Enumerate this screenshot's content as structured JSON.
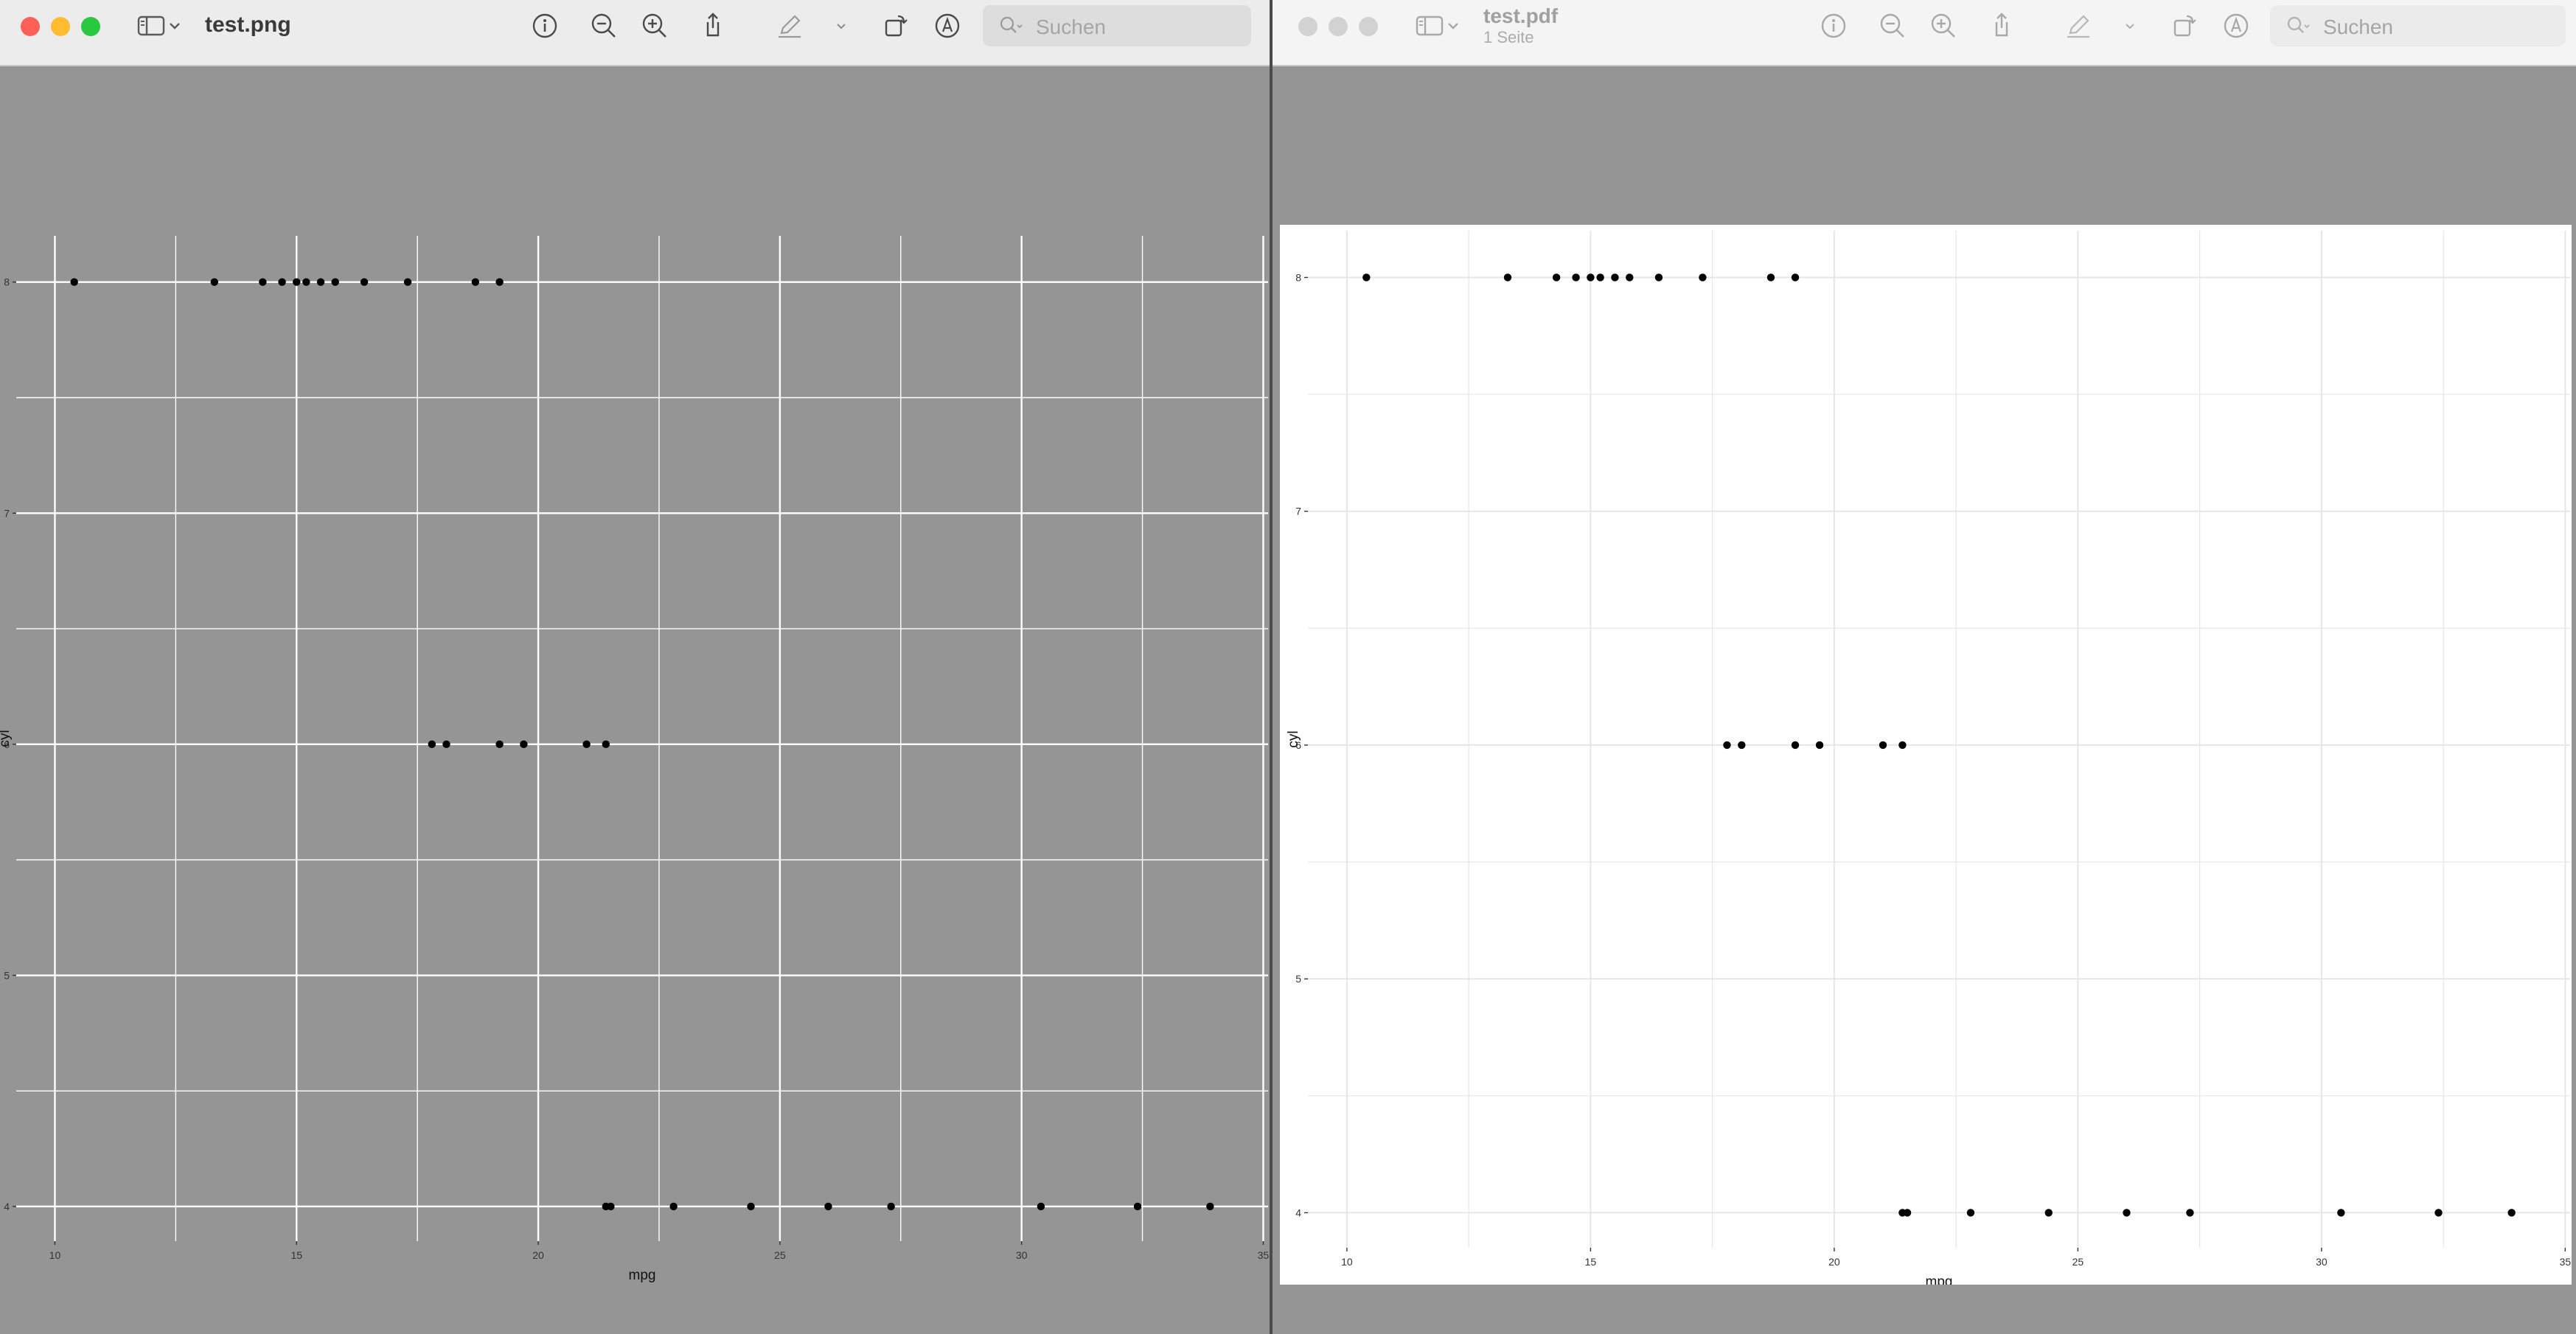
{
  "windows": [
    {
      "title": "test.png",
      "subtitle": "",
      "search_placeholder": "Suchen"
    },
    {
      "title": "test.pdf",
      "subtitle": "1 Seite",
      "search_placeholder": "Suchen"
    }
  ],
  "icons": {
    "sidebar": "sidebar-icon",
    "chevron": "chevron-down-icon",
    "info": "info-icon",
    "zoom_out": "zoom-out-icon",
    "zoom_in": "zoom-in-icon",
    "share": "share-icon",
    "markup": "pencil-icon",
    "rotate": "rotate-icon",
    "annotate": "markup-icon",
    "search": "search-icon"
  },
  "colors": {
    "close": "#fe5f57",
    "minimize": "#febc2e",
    "zoom": "#28c840",
    "inactive": "#d2d2d2",
    "png_panel_background": "#959595",
    "pdf_panel_background": "#ffffff"
  },
  "chart_data": [
    {
      "type": "scatter",
      "xlabel": "mpg",
      "ylabel": "cyl",
      "xlim": [
        9.2,
        35.1
      ],
      "ylim": [
        3.85,
        8.2
      ],
      "x_ticks": [
        "10",
        "15",
        "20",
        "25",
        "30",
        "35"
      ],
      "y_ticks": [
        "4",
        "5",
        "6",
        "7",
        "8"
      ],
      "grid": true,
      "legend": "none",
      "background": "grey",
      "points": [
        {
          "x": 10.4,
          "y": 8
        },
        {
          "x": 13.3,
          "y": 8
        },
        {
          "x": 14.3,
          "y": 8
        },
        {
          "x": 14.7,
          "y": 8
        },
        {
          "x": 15.0,
          "y": 8
        },
        {
          "x": 15.2,
          "y": 8
        },
        {
          "x": 15.5,
          "y": 8
        },
        {
          "x": 15.8,
          "y": 8
        },
        {
          "x": 16.4,
          "y": 8
        },
        {
          "x": 17.3,
          "y": 8
        },
        {
          "x": 18.7,
          "y": 8
        },
        {
          "x": 19.2,
          "y": 8
        },
        {
          "x": 17.8,
          "y": 6
        },
        {
          "x": 18.1,
          "y": 6
        },
        {
          "x": 19.2,
          "y": 6
        },
        {
          "x": 19.7,
          "y": 6
        },
        {
          "x": 21.0,
          "y": 6
        },
        {
          "x": 21.4,
          "y": 6
        },
        {
          "x": 21.4,
          "y": 4
        },
        {
          "x": 21.5,
          "y": 4
        },
        {
          "x": 22.8,
          "y": 4
        },
        {
          "x": 24.4,
          "y": 4
        },
        {
          "x": 26.0,
          "y": 4
        },
        {
          "x": 27.3,
          "y": 4
        },
        {
          "x": 30.4,
          "y": 4
        },
        {
          "x": 32.4,
          "y": 4
        },
        {
          "x": 33.9,
          "y": 4
        }
      ]
    },
    {
      "type": "scatter",
      "xlabel": "mpg",
      "ylabel": "cyl",
      "xlim": [
        9.2,
        35.1
      ],
      "ylim": [
        3.85,
        8.2
      ],
      "x_ticks": [
        "10",
        "15",
        "20",
        "25",
        "30",
        "35"
      ],
      "y_ticks": [
        "4",
        "5",
        "6",
        "7",
        "8"
      ],
      "grid": true,
      "legend": "none",
      "background": "white",
      "points": [
        {
          "x": 10.4,
          "y": 8
        },
        {
          "x": 13.3,
          "y": 8
        },
        {
          "x": 14.3,
          "y": 8
        },
        {
          "x": 14.7,
          "y": 8
        },
        {
          "x": 15.0,
          "y": 8
        },
        {
          "x": 15.2,
          "y": 8
        },
        {
          "x": 15.5,
          "y": 8
        },
        {
          "x": 15.8,
          "y": 8
        },
        {
          "x": 16.4,
          "y": 8
        },
        {
          "x": 17.3,
          "y": 8
        },
        {
          "x": 18.7,
          "y": 8
        },
        {
          "x": 19.2,
          "y": 8
        },
        {
          "x": 17.8,
          "y": 6
        },
        {
          "x": 18.1,
          "y": 6
        },
        {
          "x": 19.2,
          "y": 6
        },
        {
          "x": 19.7,
          "y": 6
        },
        {
          "x": 21.0,
          "y": 6
        },
        {
          "x": 21.4,
          "y": 6
        },
        {
          "x": 21.4,
          "y": 4
        },
        {
          "x": 21.5,
          "y": 4
        },
        {
          "x": 22.8,
          "y": 4
        },
        {
          "x": 24.4,
          "y": 4
        },
        {
          "x": 26.0,
          "y": 4
        },
        {
          "x": 27.3,
          "y": 4
        },
        {
          "x": 30.4,
          "y": 4
        },
        {
          "x": 32.4,
          "y": 4
        },
        {
          "x": 33.9,
          "y": 4
        }
      ]
    }
  ]
}
